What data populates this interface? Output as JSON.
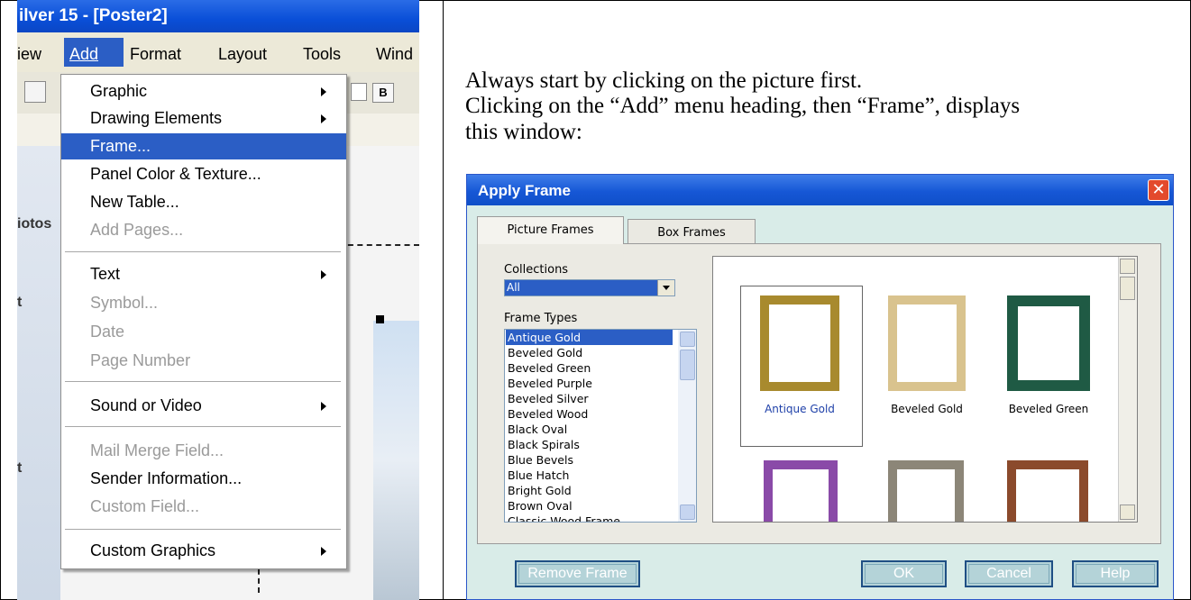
{
  "app": {
    "title": "ilver 15 - [Poster2]",
    "menubar": [
      "iew",
      "Add",
      "Format",
      "Layout",
      "Tools",
      "Wind"
    ]
  },
  "left_labels": [
    "iotos",
    "t",
    "t"
  ],
  "add_menu": {
    "items": [
      {
        "label": "Graphic",
        "submenu": true
      },
      {
        "label": "Drawing Elements",
        "submenu": true
      },
      {
        "label": "Frame...",
        "selected": true
      },
      {
        "label": "Panel Color & Texture..."
      },
      {
        "label": "New Table..."
      },
      {
        "label": "Add Pages...",
        "disabled": true
      },
      {
        "label": "Text",
        "submenu": true
      },
      {
        "label": "Symbol...",
        "disabled": true
      },
      {
        "label": "Date",
        "disabled": true
      },
      {
        "label": "Page Number",
        "disabled": true
      },
      {
        "label": "Sound or Video",
        "submenu": true
      },
      {
        "label": "Mail Merge Field...",
        "disabled": true
      },
      {
        "label": "Sender Information..."
      },
      {
        "label": "Custom Field...",
        "disabled": true
      },
      {
        "label": "Custom Graphics",
        "submenu": true
      }
    ]
  },
  "instructions": {
    "line1": "Always start by clicking on the picture first.",
    "line2": "Clicking on the “Add” menu heading, then “Frame”, displays",
    "line3": "this window:"
  },
  "dialog": {
    "title": "Apply Frame",
    "close_glyph": "✕",
    "tabs": [
      "Picture Frames",
      "Box Frames"
    ],
    "collections_label": "Collections",
    "collections_value": "All",
    "frame_types_label": "Frame Types",
    "frame_types": [
      "Antique Gold",
      "Beveled Gold",
      "Beveled Green",
      "Beveled Purple",
      "Beveled Silver",
      "Beveled Wood",
      "Black Oval",
      "Black Spirals",
      "Blue Bevels",
      "Blue Hatch",
      "Bright Gold",
      "Brown Oval",
      "Classic Wood Frame"
    ],
    "gallery_captions": [
      "Antique Gold",
      "Beveled Gold",
      "Beveled Green"
    ],
    "buttons": {
      "remove": "Remove Frame",
      "ok": "OK",
      "cancel": "Cancel",
      "help": "Help"
    },
    "colors": {
      "antique_gold": "#a88a2e",
      "beveled_gold": "#d9c38e",
      "beveled_green": "#1f5a44",
      "beveled_purple": "#8a4aa8",
      "beveled_silver": "#8c8678",
      "beveled_wood": "#8b4a2c",
      "selected_caption": "#1d3fa8"
    }
  }
}
